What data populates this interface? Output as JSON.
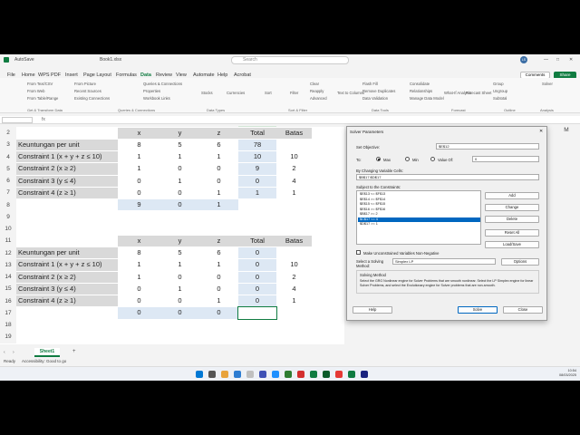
{
  "titlebar": {
    "autosave": "AutoSave",
    "filename": "Book1.xlsx",
    "search_placeholder": "Search",
    "user_initials": "LS"
  },
  "menu": [
    "File",
    "Home",
    "WPS PDF",
    "Insert",
    "Page Layout",
    "Formulas",
    "Data",
    "Review",
    "View",
    "Automate",
    "Help",
    "Acrobat"
  ],
  "menu_active": "Data",
  "buttons": {
    "comments": "Comments",
    "share": "Share"
  },
  "ribbon": {
    "groups": [
      "Get & Transform Data",
      "Queries & Connections",
      "Data Types",
      "Sort & Filter",
      "Data Tools",
      "Forecast",
      "Outline",
      "Analysis"
    ],
    "items": [
      "From Text/CSV",
      "From Web",
      "From Table/Range",
      "From Picture",
      "Recent Sources",
      "Existing Connections",
      "Queries & Connections",
      "Properties",
      "Workbook Links",
      "Stocks",
      "Currencies",
      "Sort",
      "Filter",
      "Clear",
      "Reapply",
      "Advanced",
      "Text to Columns",
      "Flash Fill",
      "Remove Duplicates",
      "Data Validation",
      "Consolidate",
      "Relationships",
      "Manage Data Model",
      "What-If Analysis",
      "Forecast Sheet",
      "Group",
      "Ungroup",
      "Subtotal",
      "Solver"
    ]
  },
  "columns": [
    "A",
    "B",
    "C",
    "D",
    "E",
    "F"
  ],
  "extra_cols": [
    "M"
  ],
  "rows": [
    {
      "n": "2",
      "a": "",
      "b": "x",
      "c": "y",
      "d": "z",
      "e": "Total",
      "f": "Batas",
      "kind": "head"
    },
    {
      "n": "3",
      "a": "Keuntungan per unit",
      "b": "8",
      "c": "5",
      "d": "6",
      "e": "78",
      "f": ""
    },
    {
      "n": "4",
      "a": "Constraint 1 (x + y + z ≤ 10)",
      "b": "1",
      "c": "1",
      "d": "1",
      "e": "10",
      "f": "10"
    },
    {
      "n": "5",
      "a": "Constraint 2 (x ≥ 2)",
      "b": "1",
      "c": "0",
      "d": "0",
      "e": "9",
      "f": "2"
    },
    {
      "n": "6",
      "a": "Constraint 3 (y ≤ 4)",
      "b": "0",
      "c": "1",
      "d": "0",
      "e": "0",
      "f": "4"
    },
    {
      "n": "7",
      "a": "Constraint 4 (z ≥ 1)",
      "b": "0",
      "c": "0",
      "d": "1",
      "e": "1",
      "f": "1"
    },
    {
      "n": "8",
      "a": "",
      "b": "9",
      "c": "0",
      "d": "1",
      "e": "",
      "f": "",
      "kind": "var"
    },
    {
      "n": "9",
      "a": "",
      "b": "",
      "c": "",
      "d": "",
      "e": "",
      "f": ""
    },
    {
      "n": "10",
      "a": "",
      "b": "",
      "c": "",
      "d": "",
      "e": "",
      "f": ""
    },
    {
      "n": "11",
      "a": "",
      "b": "x",
      "c": "y",
      "d": "z",
      "e": "Total",
      "f": "Batas",
      "kind": "head"
    },
    {
      "n": "12",
      "a": "Keuntungan per unit",
      "b": "8",
      "c": "5",
      "d": "6",
      "e": "0",
      "f": ""
    },
    {
      "n": "13",
      "a": "Constraint 1 (x + y + z ≤ 10)",
      "b": "1",
      "c": "1",
      "d": "1",
      "e": "0",
      "f": "10"
    },
    {
      "n": "14",
      "a": "Constraint 2 (x ≥ 2)",
      "b": "1",
      "c": "0",
      "d": "0",
      "e": "0",
      "f": "2"
    },
    {
      "n": "15",
      "a": "Constraint 3 (y ≤ 4)",
      "b": "0",
      "c": "1",
      "d": "0",
      "e": "0",
      "f": "4"
    },
    {
      "n": "16",
      "a": "Constraint 4 (z ≥ 1)",
      "b": "0",
      "c": "0",
      "d": "1",
      "e": "0",
      "f": "1"
    },
    {
      "n": "17",
      "a": "",
      "b": "0",
      "c": "0",
      "d": "0",
      "e": "",
      "f": "",
      "kind": "var"
    },
    {
      "n": "18",
      "a": "",
      "b": "",
      "c": "",
      "d": "",
      "e": "",
      "f": ""
    },
    {
      "n": "19",
      "a": "",
      "b": "",
      "c": "",
      "d": "",
      "e": "",
      "f": ""
    }
  ],
  "sheet_tab": "Sheet1",
  "status": {
    "ready": "Ready",
    "accessibility": "Accessibility: Good to go"
  },
  "dialog": {
    "title": "Solver Parameters",
    "set_objective_label": "Set Objective:",
    "set_objective_value": "$E$12",
    "to_label": "To:",
    "max_label": "Max",
    "min_label": "Min",
    "value_of_label": "Value Of:",
    "value_of_value": "0",
    "changing_label": "By Changing Variable Cells:",
    "changing_value": "$B$17:$D$17",
    "subject_label": "Subject to the Constraints:",
    "constraints": [
      "$E$13 <= $F$13",
      "$E$14 >= $F$14",
      "$E$15 <= $F$15",
      "$E$16 >= $F$16",
      "$B$17 >= 2",
      "$C$17 <= 4",
      "$D$17 >= 1"
    ],
    "selected_constraint": 5,
    "add": "Add",
    "change": "Change",
    "delete": "Delete",
    "reset_all": "Reset All",
    "load_save": "Load/Save",
    "nonneg_label": "Make Unconstrained Variables Non-Negative",
    "method_label": "Select a Solving Method:",
    "method_value": "Simplex LP",
    "options": "Options",
    "solving_method_title": "Solving Method",
    "solving_method_text": "Select the GRG Nonlinear engine for Solver Problems that are smooth nonlinear. Select the LP Simplex engine for linear Solver Problems, and select the Evolutionary engine for Solver problems that are non-smooth.",
    "help": "Help",
    "solve": "Solve",
    "close": "Close"
  },
  "clock": {
    "time": "10:54",
    "date": "08/03/2025"
  }
}
